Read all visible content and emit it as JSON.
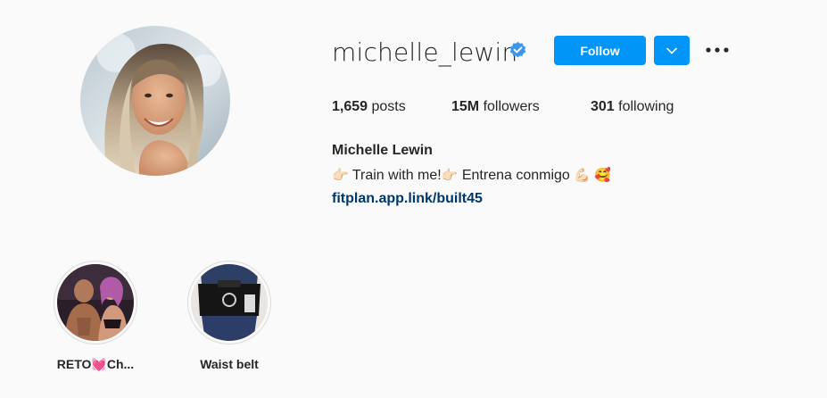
{
  "profile": {
    "username": "michelle_lewin",
    "verified": true,
    "follow_label": "Follow",
    "dropdown_icon": "chevron-down-icon",
    "more_icon": "more-horizontal-icon",
    "avatar_alt": "michelle_lewin's profile picture"
  },
  "stats": {
    "posts_count": "1,659",
    "posts_label": " posts",
    "followers_count": "15M",
    "followers_label": " followers",
    "following_count": "301",
    "following_label": " following"
  },
  "bio": {
    "full_name": "Michelle Lewin",
    "line_part1": " Train with me!",
    "line_part2": " Entrena conmigo",
    "emoji_point": "👉🏻",
    "emoji_muscle": "💪🏻",
    "emoji_love": "🥰",
    "link": "fitplan.app.link/built45"
  },
  "highlights": [
    {
      "label": "RETO💓Ch..."
    },
    {
      "label": "Waist belt"
    }
  ],
  "colors": {
    "accent": "#0095f6",
    "link": "#00376b",
    "verified": "#3897f0",
    "background": "#fafafa",
    "text": "#262626"
  }
}
